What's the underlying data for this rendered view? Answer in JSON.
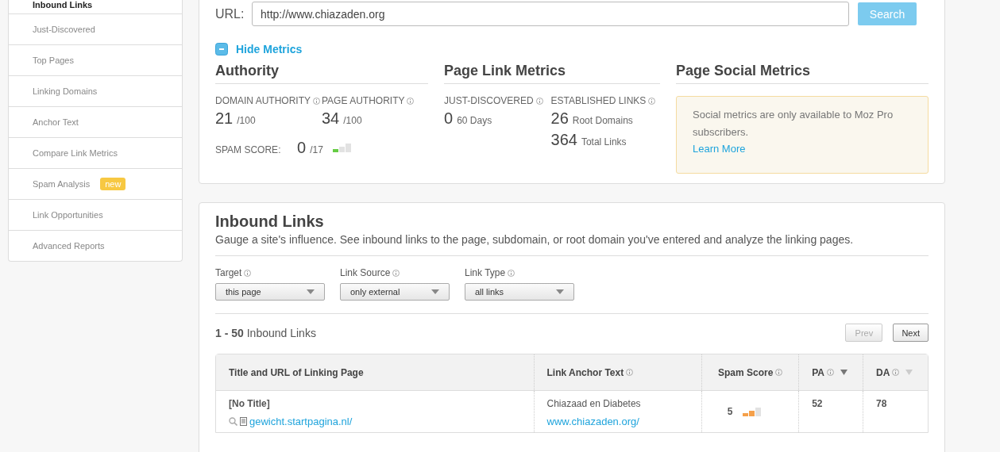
{
  "sidebar": {
    "items": [
      {
        "label": "Inbound Links",
        "selected": true
      },
      {
        "label": "Just-Discovered",
        "selected": false
      },
      {
        "label": "Top Pages",
        "selected": false
      },
      {
        "label": "Linking Domains",
        "selected": false
      },
      {
        "label": "Anchor Text",
        "selected": false
      },
      {
        "label": "Compare Link Metrics",
        "selected": false
      },
      {
        "label": "Spam Analysis",
        "selected": false,
        "badge": "new"
      },
      {
        "label": "Link Opportunities",
        "selected": false
      },
      {
        "label": "Advanced Reports",
        "selected": false
      }
    ]
  },
  "search": {
    "label": "URL:",
    "value": "http://www.chiazaden.org",
    "button": "Search",
    "button_disabled": true
  },
  "metrics_toggle": {
    "label": "Hide Metrics",
    "expanded": true
  },
  "authority": {
    "title": "Authority",
    "items": [
      {
        "label": "DOMAIN AUTHORITY",
        "value": "21",
        "suffix": "/100"
      },
      {
        "label": "PAGE AUTHORITY",
        "value": "34",
        "suffix": "/100"
      }
    ],
    "spam": {
      "label": "SPAM SCORE:",
      "value": "0",
      "suffix": "/17",
      "level": 0.33,
      "color": "#66cc44"
    }
  },
  "page_link_metrics": {
    "title": "Page Link Metrics",
    "columns": [
      {
        "label": "JUST-DISCOVERED",
        "rows": [
          {
            "value": "0",
            "suffix": "60 Days"
          }
        ]
      },
      {
        "label": "ESTABLISHED LINKS",
        "rows": [
          {
            "value": "26",
            "suffix": "Root Domains"
          },
          {
            "value": "364",
            "suffix": "Total Links"
          }
        ]
      }
    ]
  },
  "social": {
    "title": "Page Social Metrics",
    "notice": "Social metrics are only available to Moz Pro subscribers.",
    "link": "Learn More"
  },
  "inbound": {
    "title": "Inbound Links",
    "description": "Gauge a site's influence. See inbound links to the page, subdomain, or root domain you've entered and analyze the linking pages.",
    "filters": [
      {
        "label": "Target",
        "value": "this page"
      },
      {
        "label": "Link Source",
        "value": "only external"
      },
      {
        "label": "Link Type",
        "value": "all links"
      }
    ],
    "count": "**1 - 50** Inbound Links",
    "pager": [
      {
        "label": "Prev",
        "disabled": true
      },
      {
        "label": "Next",
        "disabled": false
      }
    ],
    "table": {
      "columns": [
        {
          "label": "Title and URL of Linking Page",
          "info": false,
          "sortable": false
        },
        {
          "label": "Link Anchor Text",
          "info": true,
          "sortable": false
        },
        {
          "label": "Spam Score",
          "info": true,
          "sortable": false
        },
        {
          "label": "PA",
          "info": true,
          "sortable": true,
          "sorted": true
        },
        {
          "label": "DA",
          "info": true,
          "sortable": true,
          "sorted": false
        }
      ],
      "rows": [
        {
          "title": "[No Title]",
          "url": "gewicht.startpagina.nl/",
          "anchor": "Chiazaad en Diabetes",
          "anchor_url": "www.chiazaden.org/",
          "spam": "5",
          "spam_meter": {
            "level": 0.67,
            "color": "#f5a04a"
          },
          "pa": "52",
          "da": "78"
        }
      ]
    }
  }
}
